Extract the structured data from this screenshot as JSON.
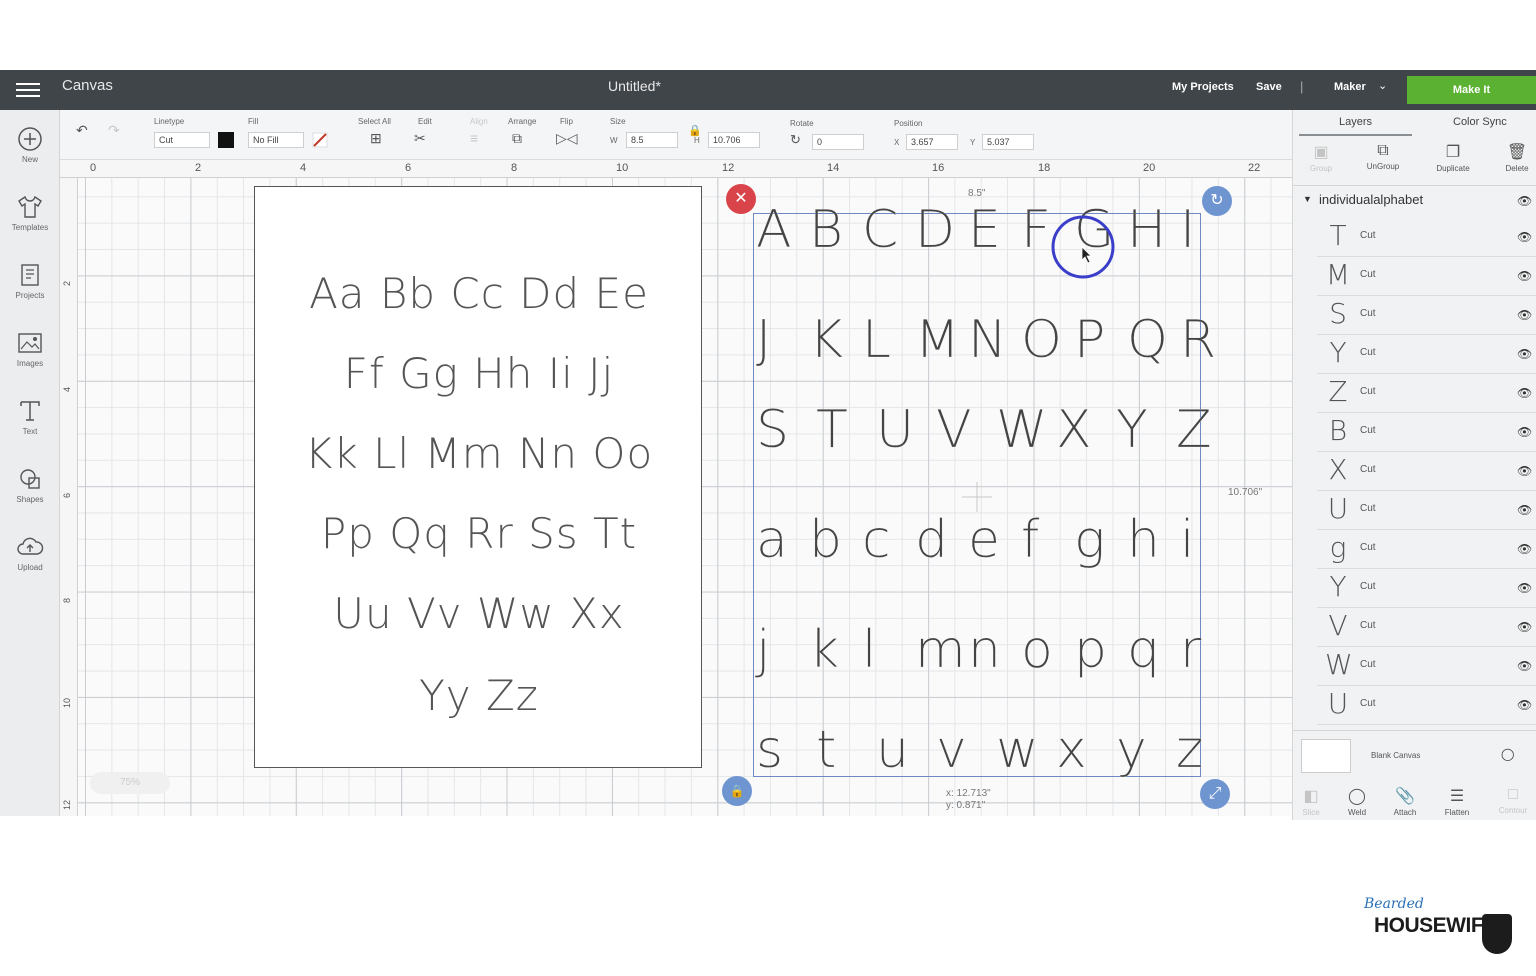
{
  "header": {
    "app_name": "Canvas",
    "doc_title": "Untitled*",
    "my_projects": "My Projects",
    "save": "Save",
    "separator": "|",
    "machine": "Maker",
    "make_it": "Make It",
    "make_it_color": "#5bb132"
  },
  "left_tools": [
    {
      "label": "New",
      "icon": "plus-circle-icon"
    },
    {
      "label": "Templates",
      "icon": "tshirt-icon"
    },
    {
      "label": "Projects",
      "icon": "projects-icon"
    },
    {
      "label": "Images",
      "icon": "image-icon"
    },
    {
      "label": "Text",
      "icon": "text-icon"
    },
    {
      "label": "Shapes",
      "icon": "shapes-icon"
    },
    {
      "label": "Upload",
      "icon": "cloud-upload-icon"
    }
  ],
  "toolbar": {
    "linetype_label": "Linetype",
    "linetype_value": "Cut",
    "fill_label": "Fill",
    "fill_value": "No Fill",
    "select_all": "Select All",
    "edit": "Edit",
    "align": "Align",
    "arrange": "Arrange",
    "flip": "Flip",
    "size": "Size",
    "w_label": "W",
    "w_value": "8.5",
    "h_label": "H",
    "h_value": "10.706",
    "rotate": "Rotate",
    "rotate_value": "0",
    "position": "Position",
    "x_label": "X",
    "x_value": "3.657",
    "y_label": "Y",
    "y_value": "5.037"
  },
  "ruler": {
    "h_ticks": [
      "0",
      "2",
      "4",
      "6",
      "8",
      "10",
      "12",
      "14",
      "16",
      "18",
      "20",
      "22"
    ],
    "v_ticks": [
      "2",
      "4",
      "6",
      "8",
      "10",
      "12"
    ]
  },
  "sheet": {
    "rows": [
      "Aa Bb Cc Dd Ee",
      "Ff Gg Hh Ii Jj",
      "Kk Ll Mm Nn Oo",
      "Pp Qq Rr Ss Tt",
      "Uu Vv Ww Xx",
      "Yy Zz"
    ]
  },
  "selection": {
    "width_label": "8.5\"",
    "height_label": "10.706\"",
    "cursor_x": "x: 12.713\"",
    "cursor_y": "y: 0.871\"",
    "rows": [
      [
        "A",
        "B",
        "C",
        "D",
        "E",
        "F",
        "G",
        "H",
        "I"
      ],
      [
        "J",
        "K",
        "L",
        "M",
        "N",
        "O",
        "P",
        "Q",
        "R"
      ],
      [
        "S",
        "T",
        "U",
        "V",
        "W",
        "X",
        "Y",
        "Z"
      ],
      [
        "a",
        "b",
        "c",
        "d",
        "e",
        "f",
        "g",
        "h",
        "i"
      ],
      [
        "j",
        "k",
        "l",
        "m",
        "n",
        "o",
        "p",
        "q",
        "r"
      ],
      [
        "s",
        "t",
        "u",
        "v",
        "w",
        "x",
        "y",
        "z"
      ]
    ],
    "highlight_color": "#3a3ec9"
  },
  "zoom": "75%",
  "layers_panel": {
    "tab_layers": "Layers",
    "tab_color_sync": "Color Sync",
    "ops": [
      "Group",
      "UnGroup",
      "Duplicate",
      "Delete"
    ],
    "group_name": "individualalphabet",
    "items": [
      {
        "glyph": "T",
        "type": "Cut"
      },
      {
        "glyph": "M",
        "type": "Cut"
      },
      {
        "glyph": "S",
        "type": "Cut"
      },
      {
        "glyph": "Y",
        "type": "Cut"
      },
      {
        "glyph": "Z",
        "type": "Cut"
      },
      {
        "glyph": "B",
        "type": "Cut"
      },
      {
        "glyph": "X",
        "type": "Cut"
      },
      {
        "glyph": "U",
        "type": "Cut"
      },
      {
        "glyph": "g",
        "type": "Cut"
      },
      {
        "glyph": "Y",
        "type": "Cut"
      },
      {
        "glyph": "V",
        "type": "Cut"
      },
      {
        "glyph": "W",
        "type": "Cut"
      },
      {
        "glyph": "U",
        "type": "Cut"
      }
    ],
    "blank_canvas": "Blank Canvas",
    "bottom_ops": [
      "Slice",
      "Weld",
      "Attach",
      "Flatten",
      "Contour"
    ]
  },
  "logo": {
    "line1": "Bearded",
    "line2": "HOUSEWIFE"
  }
}
